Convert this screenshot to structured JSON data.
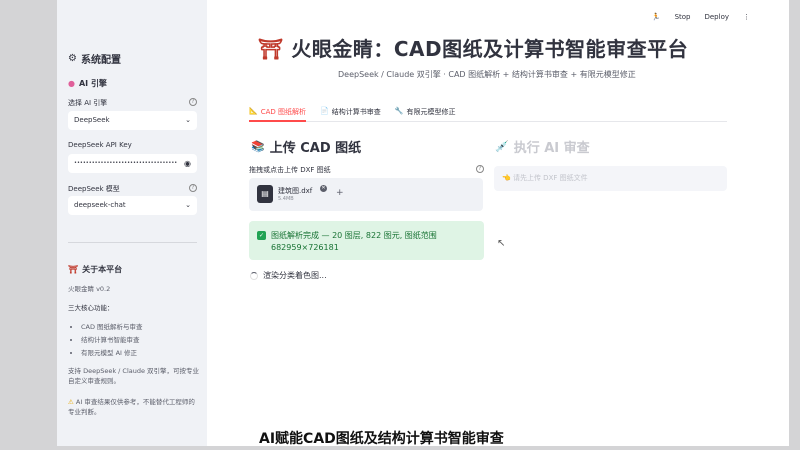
{
  "header": {
    "stop_label": "Stop",
    "deploy_label": "Deploy",
    "menu_icon": "⋮"
  },
  "sidebar": {
    "config_title": "系统配置",
    "ai_engine_title": "AI 引擎",
    "select_engine_label": "选择 AI 引擎",
    "select_engine_value": "DeepSeek",
    "api_key_label": "DeepSeek API Key",
    "api_key_value": "•••••••••••••••••••••••••••••••••••",
    "model_label": "DeepSeek 模型",
    "model_value": "deepseek-chat",
    "about_title": "关于本平台",
    "version": "火眼金睛 v0.2",
    "features_title": "三大核心功能：",
    "features": [
      "CAD 图纸解析与审查",
      "结构计算书智能审查",
      "有限元模型 AI 修正"
    ],
    "support_text": "支持 DeepSeek / Claude 双引擎，可按专业自定义审查规则。",
    "warning_text": "AI 审查结果仅供参考，不能替代工程师的专业判断。"
  },
  "main": {
    "title": "火眼金睛：CAD图纸及计算书智能审查平台",
    "subtitle": "DeepSeek / Claude 双引擎 · CAD 图纸解析 + 结构计算书审查 + 有限元模型修正",
    "tabs": [
      {
        "label": "CAD 图纸解析"
      },
      {
        "label": "结构计算书审查"
      },
      {
        "label": "有限元模型修正"
      }
    ],
    "upload_title": "上传 CAD 图纸",
    "upload_label": "拖拽或点击上传 DXF 图纸",
    "file_name": "建筑图.dxf",
    "file_size": "5.4MB",
    "success_line1": "图纸解析完成 — 20 图层, 822 图元, 图纸范围",
    "success_line2": "682959×726181",
    "rendering_text": "渲染分类着色图...",
    "review_title": "执行 AI 审查",
    "review_info": "请先上传 DXF 图纸文件"
  },
  "caption": "AI赋能CAD图纸及结构计算书智能审查"
}
